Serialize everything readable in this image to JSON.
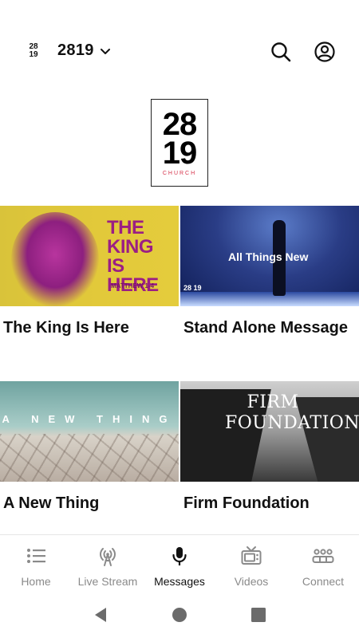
{
  "header": {
    "logo_small": [
      "28",
      "19"
    ],
    "org_name": "2819",
    "icons": [
      "chevron-down-icon",
      "search-icon",
      "account-icon"
    ]
  },
  "hero": {
    "logo_top": "28",
    "logo_bottom": "19",
    "logo_sub": "CHURCH"
  },
  "cards": [
    {
      "title": "The King Is Here",
      "thumb_text": "THE KING IS HERE",
      "thumb_sub": "MATTHEW 1-4"
    },
    {
      "title": "Stand Alone Message",
      "thumb_text": "All Things New",
      "thumb_sub": "28 19"
    },
    {
      "title": "A New Thing",
      "thumb_text": "A NEW THING"
    },
    {
      "title": "Firm Foundation",
      "thumb_text": "FIRM FOUNDATION"
    }
  ],
  "nav": {
    "items": [
      {
        "label": "Home",
        "icon": "list-icon",
        "active": false
      },
      {
        "label": "Live Stream",
        "icon": "broadcast-icon",
        "active": false
      },
      {
        "label": "Messages",
        "icon": "microphone-icon",
        "active": true
      },
      {
        "label": "Videos",
        "icon": "tv-icon",
        "active": false
      },
      {
        "label": "Connect",
        "icon": "people-icon",
        "active": false
      }
    ]
  },
  "colors": {
    "accent_logo": "#d6334b",
    "active_nav": "#111111",
    "inactive_nav": "#8a8a8a"
  }
}
